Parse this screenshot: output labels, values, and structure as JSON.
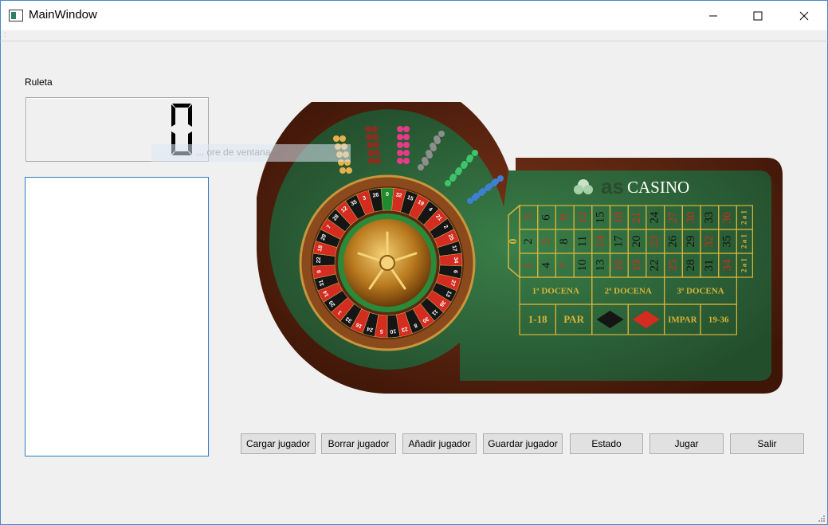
{
  "window": {
    "title": "MainWindow",
    "controls": {
      "minimize": "minimize-icon",
      "maximize": "maximize-icon",
      "close": "close-icon"
    }
  },
  "main": {
    "roulette_label": "Ruleta",
    "lcd_value": "0",
    "ghost_text": "... ore de ventana ...",
    "players_list": []
  },
  "board": {
    "brand_prefix": "as",
    "brand": "CASINO",
    "zero": "0",
    "rows": [
      [
        "3",
        "6",
        "9",
        "12",
        "15",
        "18",
        "21",
        "24",
        "27",
        "30",
        "33",
        "36"
      ],
      [
        "2",
        "5",
        "8",
        "11",
        "14",
        "17",
        "20",
        "23",
        "26",
        "29",
        "32",
        "35"
      ],
      [
        "1",
        "4",
        "7",
        "10",
        "13",
        "16",
        "19",
        "22",
        "25",
        "28",
        "31",
        "34"
      ]
    ],
    "red_numbers": [
      "1",
      "3",
      "5",
      "7",
      "9",
      "12",
      "14",
      "16",
      "18",
      "19",
      "21",
      "23",
      "25",
      "27",
      "30",
      "32",
      "34",
      "36"
    ],
    "column_bets": [
      "2 a 1",
      "2 a 1",
      "2 a 1"
    ],
    "dozens": [
      "1ª DOCENA",
      "2ª DOCENA",
      "3ª DOCENA"
    ],
    "outside": [
      "1-18",
      "PAR",
      "",
      "",
      "IMPAR",
      "19-36"
    ],
    "wheel_numbers": [
      "0",
      "32",
      "15",
      "19",
      "4",
      "21",
      "2",
      "25",
      "17",
      "34",
      "6",
      "27",
      "13",
      "36",
      "11",
      "30",
      "8",
      "23",
      "10",
      "5",
      "24",
      "16",
      "33",
      "1",
      "20",
      "14",
      "31",
      "9",
      "22",
      "18",
      "29",
      "7",
      "28",
      "12",
      "35",
      "3",
      "26"
    ]
  },
  "buttons": {
    "load_player": "Cargar jugador",
    "delete_player": "Borrar jugador",
    "add_player": "Añadir jugador",
    "save_player": "Guardar jugador",
    "status": "Estado",
    "play": "Jugar",
    "exit": "Salir"
  },
  "colors": {
    "felt": "#2f6b3c",
    "wood": "#5a2410",
    "gold": "#d9b43a",
    "red": "#d42c20",
    "accent_border": "#2f7bc4"
  }
}
